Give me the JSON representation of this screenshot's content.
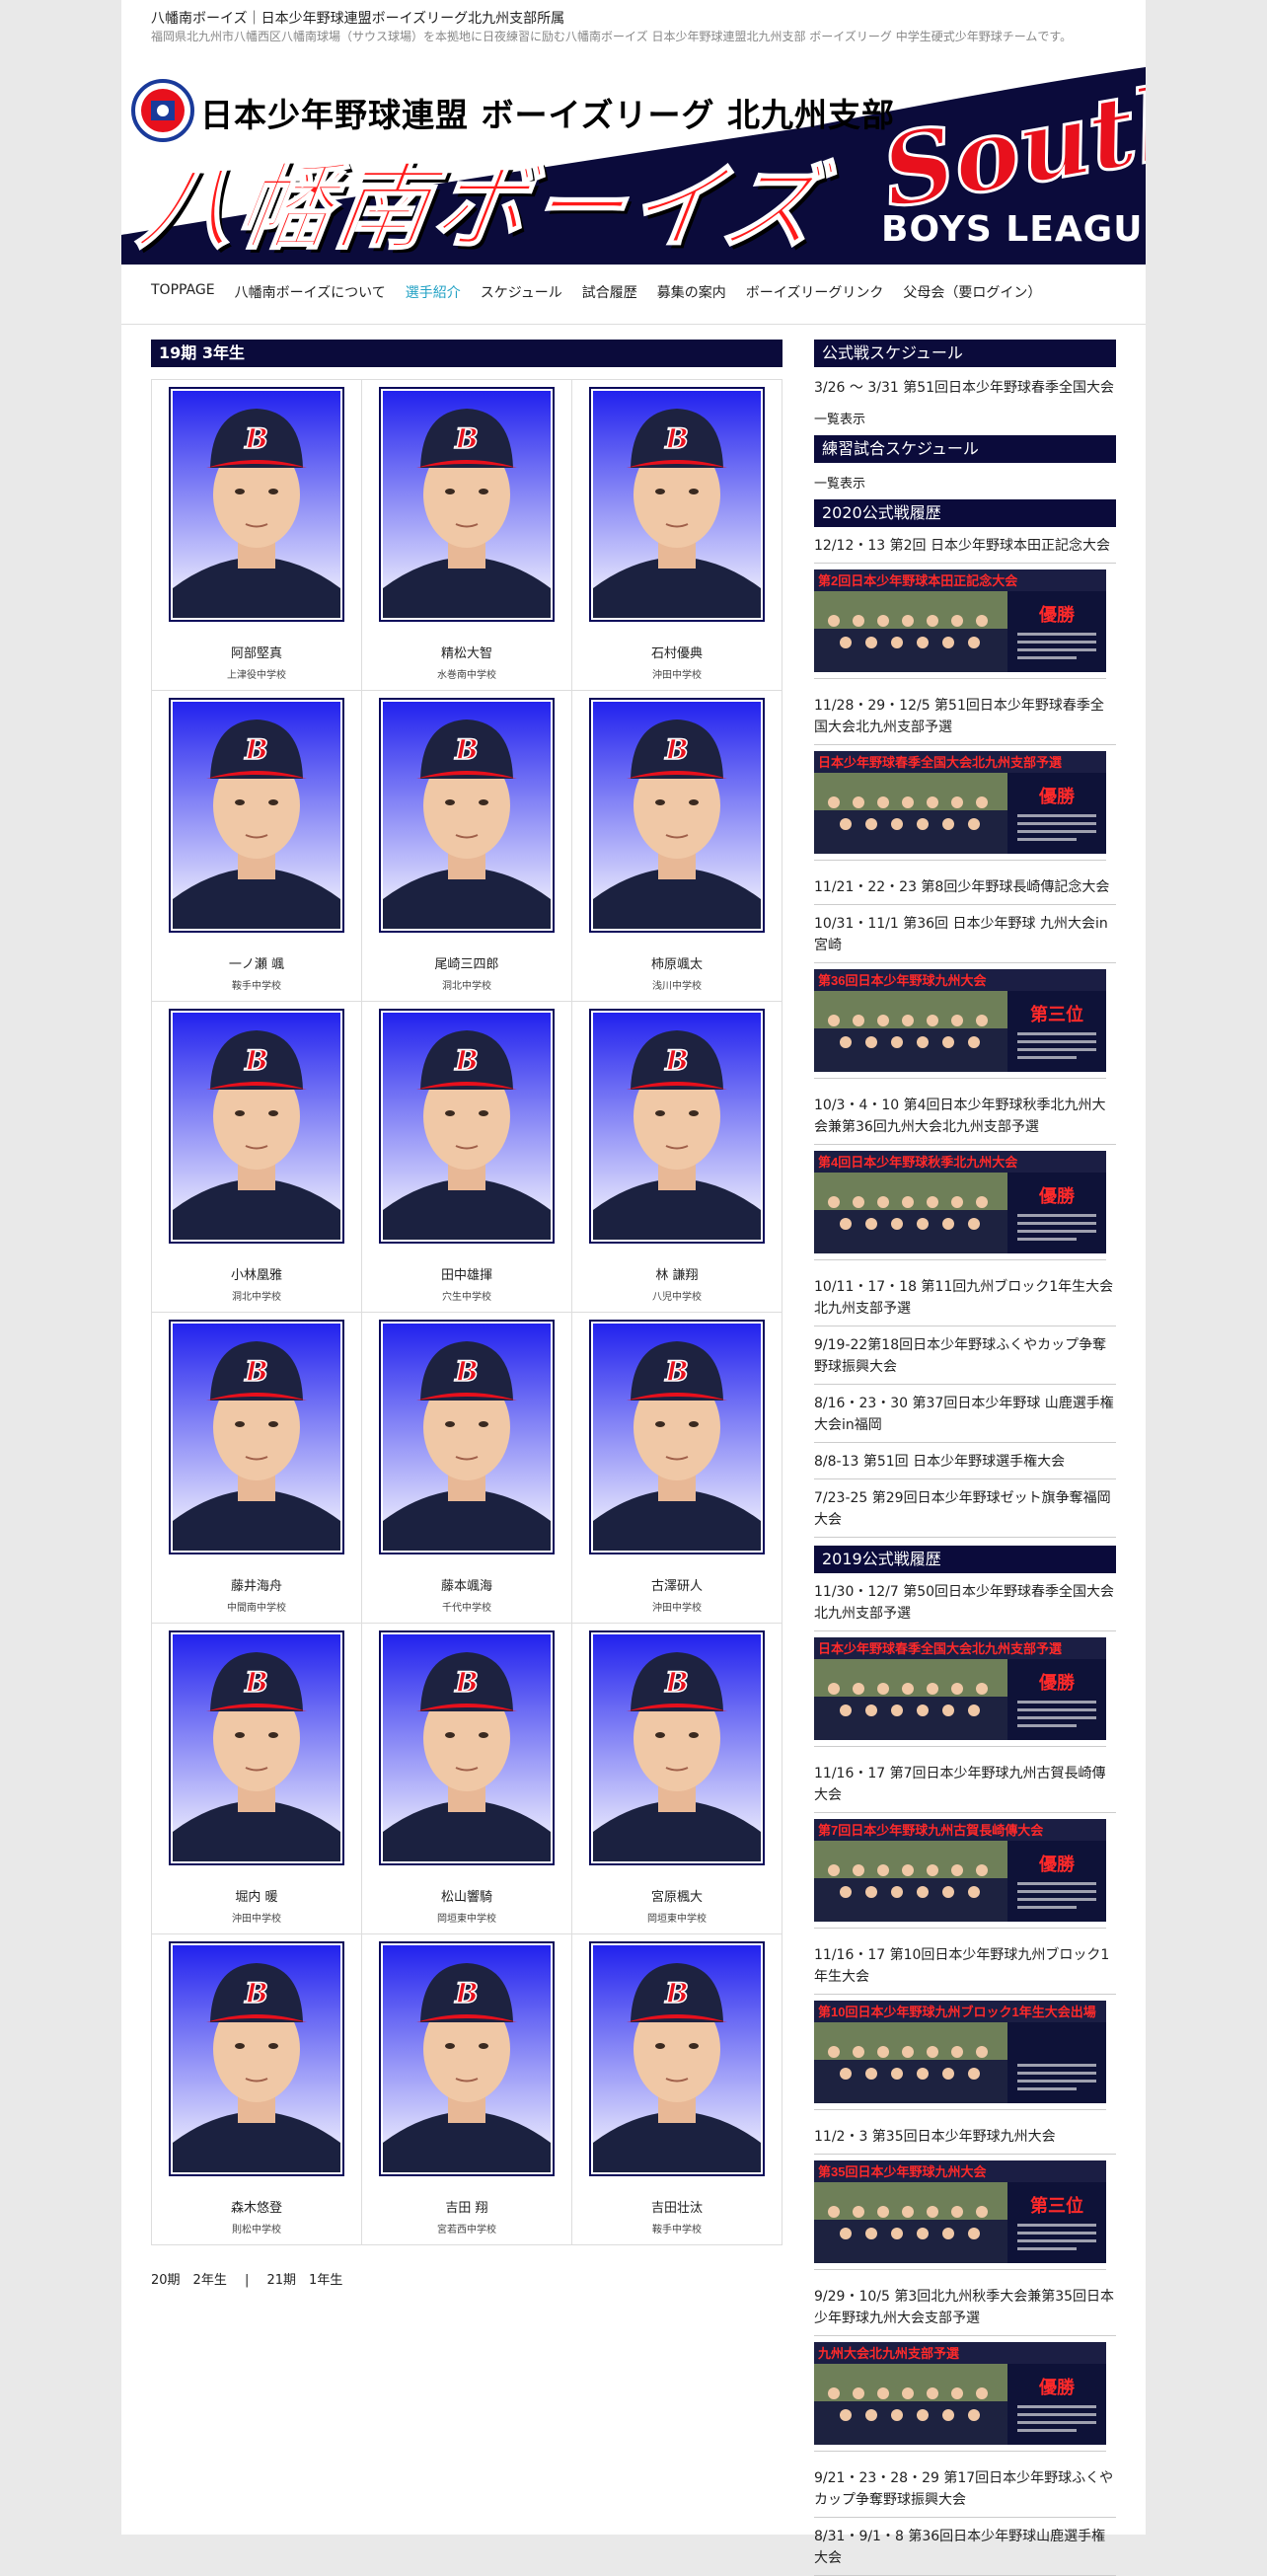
{
  "site": {
    "title": "八幡南ボーイズ｜日本少年野球連盟ボーイズリーグ北九州支部所属",
    "description": "福岡県北九州市八幡西区八幡南球場（サウス球場）を本拠地に日夜練習に励む八幡南ボーイズ 日本少年野球連盟北九州支部 ボーイズリーグ 中学生硬式少年野球チームです。"
  },
  "banner": {
    "league": "日本少年野球連盟 ボーイズリーグ 北九州支部",
    "team": "八幡南ボーイズ",
    "south": "South",
    "boys": "BOYS LEAGUE"
  },
  "nav": [
    "TOPPAGE",
    "八幡南ボーイズについて",
    "選手紹介",
    "スケジュール",
    "試合履歴",
    "募集の案内",
    "ボーイズリーグリンク",
    "父母会（要ログイン）"
  ],
  "main": {
    "heading": "19期 3年生",
    "players": [
      {
        "name": "阿部堅真",
        "school": "上津役中学校"
      },
      {
        "name": "精松大智",
        "school": "水巻南中学校"
      },
      {
        "name": "石村優典",
        "school": "沖田中学校"
      },
      {
        "name": "一ノ瀬 颯",
        "school": "鞍手中学校"
      },
      {
        "name": "尾崎三四郎",
        "school": "洞北中学校"
      },
      {
        "name": "柿原颯太",
        "school": "浅川中学校"
      },
      {
        "name": "小林凰雅",
        "school": "洞北中学校"
      },
      {
        "name": "田中雄揮",
        "school": "穴生中学校"
      },
      {
        "name": "林 謙翔",
        "school": "八児中学校"
      },
      {
        "name": "藤井海舟",
        "school": "中間南中学校"
      },
      {
        "name": "藤本颯海",
        "school": "千代中学校"
      },
      {
        "name": "古澤研人",
        "school": "沖田中学校"
      },
      {
        "name": "堀内 暖",
        "school": "沖田中学校"
      },
      {
        "name": "松山響騎",
        "school": "岡垣東中学校"
      },
      {
        "name": "宮原楓大",
        "school": "岡垣東中学校"
      },
      {
        "name": "森木悠登",
        "school": "則松中学校"
      },
      {
        "name": "吉田 翔",
        "school": "宮若西中学校"
      },
      {
        "name": "吉田壮汰",
        "school": "鞍手中学校"
      }
    ],
    "pager": {
      "prev": "20期　2年生",
      "sep": "|",
      "next": "21期　1年生"
    }
  },
  "sidebar": {
    "official_head": "公式戦スケジュール",
    "official_item": "3/26 ～ 3/31 第51回日本少年野球春季全国大会",
    "official_more": "一覧表示",
    "practice_head": "練習試合スケジュール",
    "practice_more": "一覧表示",
    "h2020": "2020公式戦履歴",
    "events2020": [
      "12/12・13 第2回 日本少年野球本田正記念大会",
      "11/28・29・12/5 第51回日本少年野球春季全国大会北九州支部予選",
      "11/21・22・23 第8回少年野球長崎傳記念大会",
      "10/31・11/1 第36回 日本少年野球 九州大会in宮崎",
      "10/3・4・10 第4回日本少年野球秋季北九州大会兼第36回九州大会北九州支部予選",
      "10/11・17・18 第11回九州ブロック1年生大会北九州支部予選",
      "9/19-22第18回日本少年野球ふくやカップ争奪野球振興大会",
      "8/16・23・30 第37回日本少年野球 山鹿選手権大会in福岡",
      "8/8-13 第51回 日本少年野球選手権大会",
      "7/23-25 第29回日本少年野球ゼット旗争奪福岡大会"
    ],
    "h2019": "2019公式戦履歴",
    "events2019": [
      "11/30・12/7 第50回日本少年野球春季全国大会北九州支部予選",
      "11/16・17 第7回日本少年野球九州古賀長崎傳大会",
      "11/16・17 第10回日本少年野球九州ブロック1年生大会",
      "11/2・3 第35回日本少年野球九州大会",
      "9/29・10/5 第3回北九州秋季大会兼第35回日本少年野球九州大会支部予選",
      "9/21・23・28・29 第17回日本少年野球ふくやカップ争奪野球振興大会",
      "8/31・9/1・8 第36回日本少年野球山鹿選手権大会"
    ],
    "thumbs": [
      {
        "caption": "第2回日本少年野球本田正記念大会",
        "badge": "優勝"
      },
      {
        "caption": "日本少年野球春季全国大会北九州支部予選",
        "badge": "優勝"
      },
      {
        "caption": "第36回日本少年野球九州大会",
        "badge": "第三位"
      },
      {
        "caption": "第4回日本少年野球秋季北九州大会",
        "badge": "優勝"
      },
      {
        "caption": "日本少年野球春季全国大会北九州支部予選",
        "badge": "優勝"
      },
      {
        "caption": "第7回日本少年野球九州古賀長崎傳大会",
        "badge": "優勝"
      },
      {
        "caption": "第10回日本少年野球九州ブロック1年生大会出場",
        "badge": ""
      },
      {
        "caption": "第35回日本少年野球九州大会",
        "badge": "第三位"
      },
      {
        "caption": "九州大会北九州支部予選",
        "badge": "優勝"
      }
    ]
  },
  "colors": {
    "navy": "#0b0b3b",
    "accent": "#21a1c4",
    "red": "#e8101c",
    "photo_blue": "#3a3af0"
  }
}
